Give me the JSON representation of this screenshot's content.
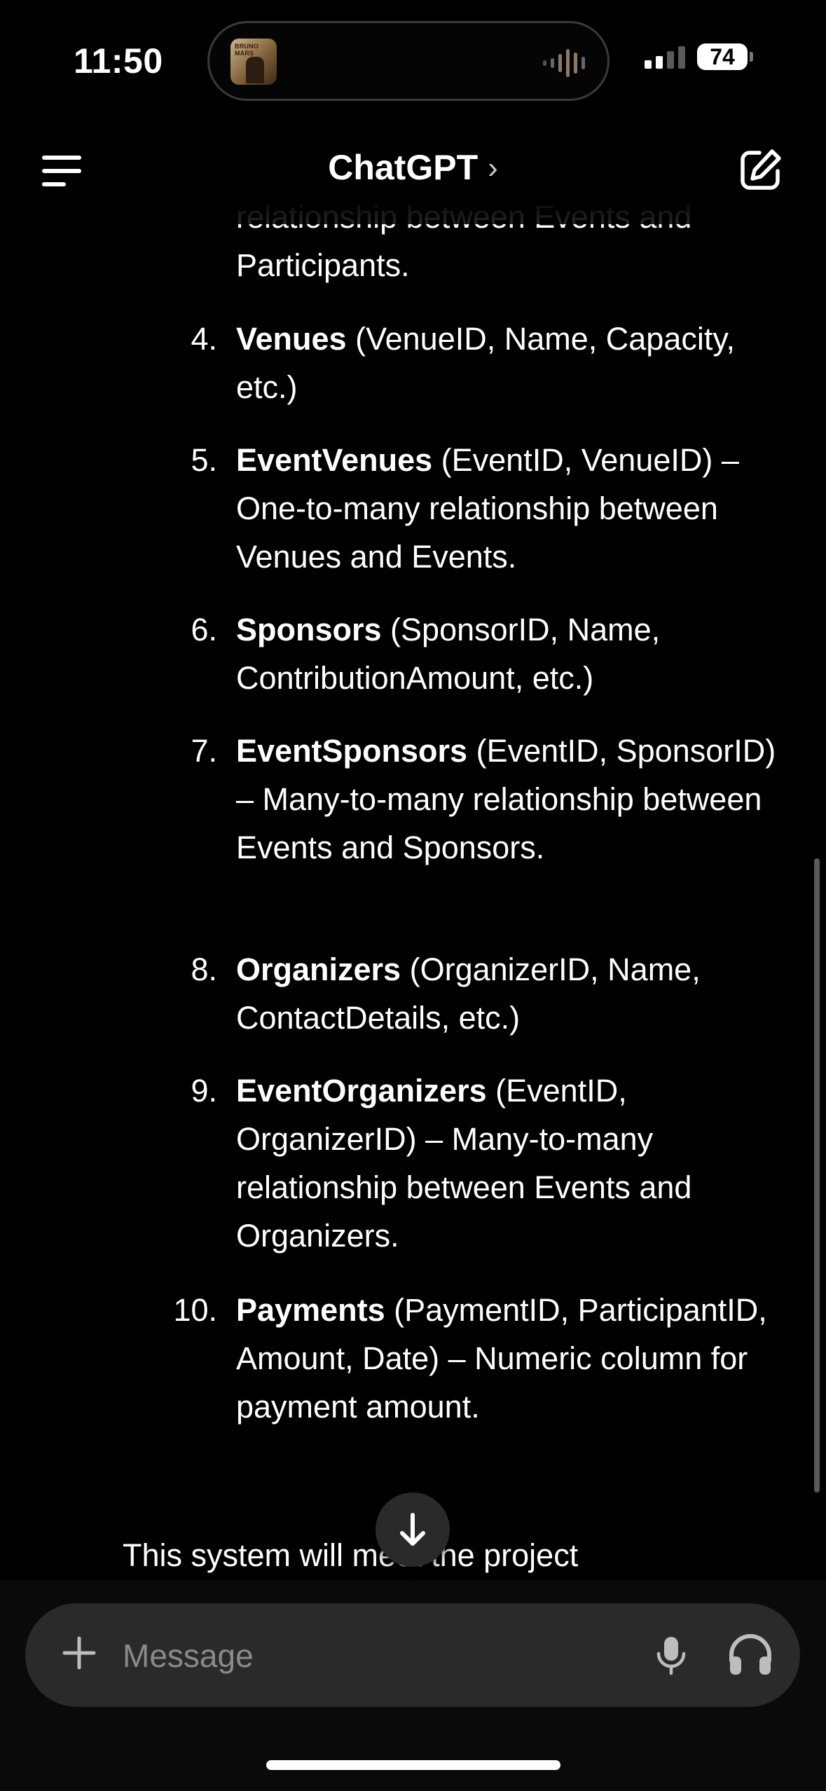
{
  "status": {
    "time": "11:50",
    "battery": "74",
    "album_text": "BRUNO MARS"
  },
  "header": {
    "title": "ChatGPT",
    "title_chevron": "›"
  },
  "conversation": {
    "partial_lines": [
      "relationship between Events and",
      "Participants."
    ],
    "items": [
      {
        "num": "4.",
        "bold": "Venues",
        "rest": " (VenueID, Name, Capacity, etc.)"
      },
      {
        "num": "5.",
        "bold": "EventVenues",
        "rest": " (EventID, VenueID) – One-to-many relationship between Venues and Events."
      },
      {
        "num": "6.",
        "bold": "Sponsors",
        "rest": " (SponsorID, Name, ContributionAmount, etc.)"
      },
      {
        "num": "7.",
        "bold": "EventSponsors",
        "rest": " (EventID, SponsorID) – Many-to-many relationship between Events and Sponsors."
      },
      {
        "num": "8.",
        "bold": "Organizers",
        "rest": " (OrganizerID, Name, ContactDetails, etc.)"
      },
      {
        "num": "9.",
        "bold": "EventOrganizers",
        "rest": " (EventID, OrganizerID) – Many-to-many relationship between Events and Organizers."
      },
      {
        "num": "10.",
        "bold": "Payments",
        "rest": " (PaymentID, ParticipantID, Amount, Date) – Numeric column for payment amount."
      }
    ],
    "closing_text": "This system will meet the project"
  },
  "composer": {
    "placeholder": "Message"
  },
  "icons": {
    "menu": "menu-icon",
    "edit": "new-chat-icon",
    "scroll": "arrow-down-icon",
    "plus": "plus-icon",
    "mic": "microphone-icon",
    "voice": "headphones-icon"
  },
  "colors": {
    "background": "#000000",
    "text": "#ffffff",
    "composer": "#2a2a2a",
    "placeholder": "#8a8a8a"
  }
}
